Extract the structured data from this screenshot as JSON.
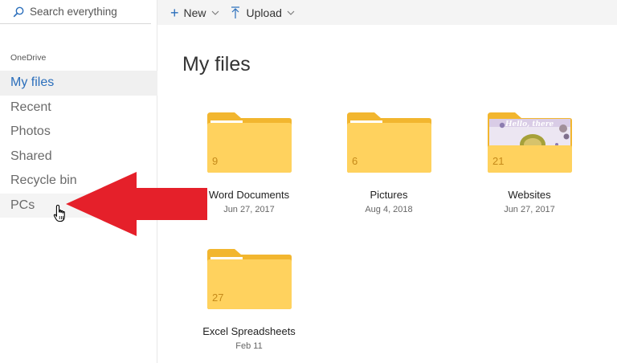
{
  "search": {
    "placeholder": "Search everything"
  },
  "sidebar": {
    "section_label": "OneDrive",
    "items": [
      {
        "label": "My files",
        "active": true
      },
      {
        "label": "Recent"
      },
      {
        "label": "Photos"
      },
      {
        "label": "Shared"
      },
      {
        "label": "Recycle bin"
      },
      {
        "label": "PCs"
      }
    ]
  },
  "toolbar": {
    "new_label": "New",
    "upload_label": "Upload"
  },
  "main": {
    "title": "My files",
    "folders": [
      {
        "name": "Word Documents",
        "date": "Jun 27, 2017",
        "count": "9"
      },
      {
        "name": "Pictures",
        "date": "Aug 4, 2018",
        "count": "6"
      },
      {
        "name": "Websites",
        "date": "Jun 27, 2017",
        "count": "21",
        "thumbnail_text": "Hello, there"
      },
      {
        "name": "Excel Spreadsheets",
        "date": "Feb 11",
        "count": "27"
      }
    ]
  },
  "colors": {
    "accent": "#2a6ebb",
    "folder": "#ffd25e",
    "arrow": "#e5202a"
  }
}
